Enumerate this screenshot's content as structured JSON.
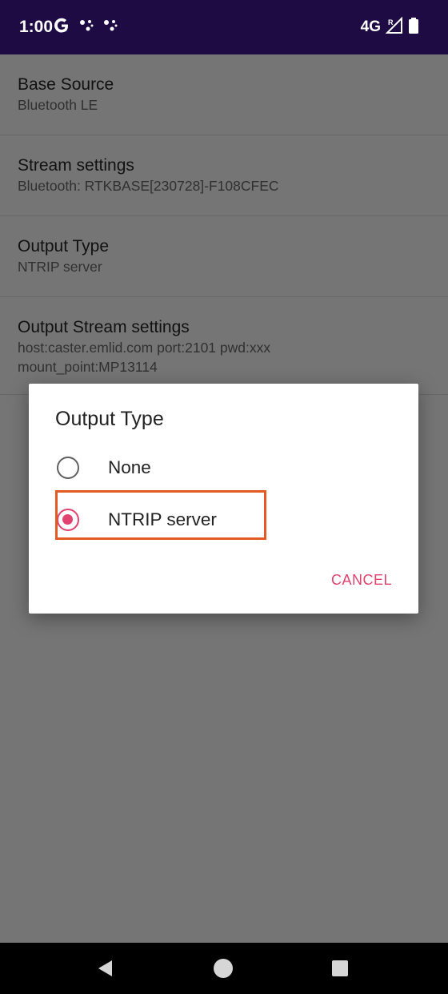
{
  "status_bar": {
    "time": "1:00",
    "network": "4G",
    "icons": [
      "google-g-icon",
      "notification-dots-icon",
      "notification-dots-icon",
      "signal-icon",
      "battery-icon"
    ],
    "background": "#1e0b44"
  },
  "preferences": [
    {
      "title": "Base Source",
      "summary": [
        "Bluetooth LE"
      ]
    },
    {
      "title": "Stream settings",
      "summary": [
        "Bluetooth: RTKBASE[230728]-F108CFEC"
      ]
    },
    {
      "title": "Output Type",
      "summary": [
        "NTRIP server"
      ]
    },
    {
      "title": "Output Stream settings",
      "summary": [
        "host:caster.emlid.com port:2101 pwd:xxx",
        "mount_point:MP13114"
      ]
    }
  ],
  "dialog": {
    "title": "Output Type",
    "options": [
      {
        "label": "None",
        "selected": false
      },
      {
        "label": "NTRIP server",
        "selected": true
      }
    ],
    "cancel_label": "CANCEL",
    "accent_color": "#e0436f",
    "highlight_color": "#e35a25"
  },
  "nav_bar": {
    "buttons": [
      "back-icon",
      "home-icon",
      "recents-icon"
    ]
  }
}
